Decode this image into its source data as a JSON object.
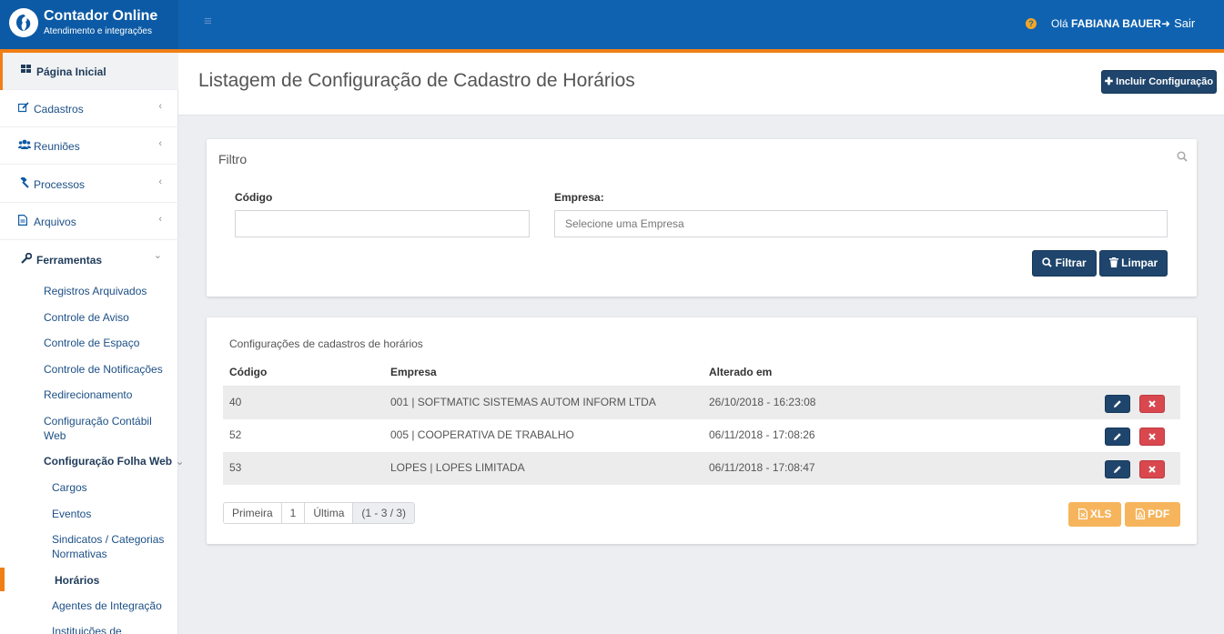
{
  "header": {
    "brand_title": "Contador Online",
    "brand_subtitle": "Atendimento e integrações",
    "menu_icon": "≡",
    "help_icon": "?",
    "greeting_prefix": "Olá",
    "user_name": "FABIANA BAUER",
    "logout_label": "Sair",
    "colors": {
      "primary": "#0f62b0",
      "accent": "#f07f16"
    }
  },
  "sidebar": {
    "home": "Página Inicial",
    "items": [
      {
        "label": "Cadastros",
        "icon": "edit-icon"
      },
      {
        "label": "Reuniões",
        "icon": "users-icon"
      },
      {
        "label": "Processos",
        "icon": "gavel-icon"
      },
      {
        "label": "Arquivos",
        "icon": "file-icon"
      }
    ],
    "tools": "Ferramentas",
    "tools_sub": [
      "Registros Arquivados",
      "Controle de Aviso",
      "Controle de Espaço",
      "Controle de Notificações",
      "Redirecionamento",
      "Configuração Contábil Web"
    ],
    "folha": "Configuração Folha Web",
    "folha_sub": [
      "Cargos",
      "Eventos",
      "Sindicatos / Categorias Normativas",
      "Horários",
      "Agentes de Integração",
      "Instituições de"
    ],
    "collapsed_chevron": "‹",
    "expanded_chevron": "⌄"
  },
  "page": {
    "title": "Listagem de Configuração de Cadastro de Horários",
    "include_button": "Incluir Configuração"
  },
  "filter": {
    "title": "Filtro",
    "code_label": "Código",
    "code_value": "",
    "company_label": "Empresa:",
    "company_placeholder": "Selecione uma Empresa",
    "filter_button": "Filtrar",
    "clear_button": "Limpar"
  },
  "list": {
    "caption": "Configurações de cadastros de horários",
    "columns": [
      "Código",
      "Empresa",
      "Alterado em"
    ],
    "rows": [
      {
        "code": "40",
        "company": "001 | SOFTMATIC SISTEMAS AUTOM INFORM LTDA",
        "changed": "26/10/2018 - 16:23:08"
      },
      {
        "code": "52",
        "company": "005 | COOPERATIVA DE TRABALHO",
        "changed": "06/11/2018 - 17:08:26"
      },
      {
        "code": "53",
        "company": "LOPES | LOPES LIMITADA",
        "changed": "06/11/2018 - 17:08:47"
      }
    ],
    "pager": {
      "first": "Primeira",
      "page": "1",
      "last": "Última",
      "info": "(1 - 3 / 3)"
    },
    "xls_button": "XLS",
    "pdf_button": "PDF"
  }
}
